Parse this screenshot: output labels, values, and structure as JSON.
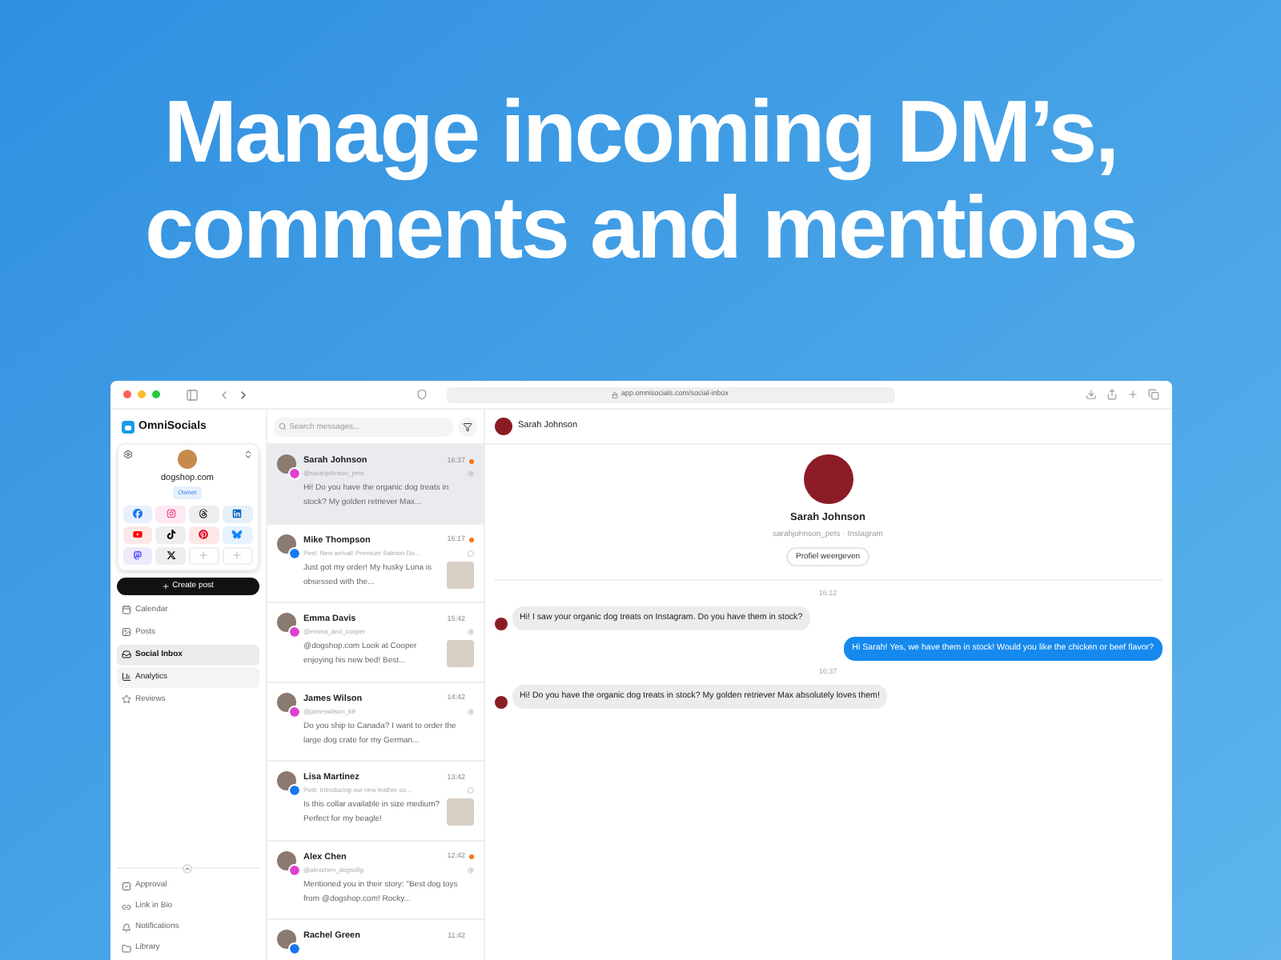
{
  "headline": [
    "Manage incoming DM’s,",
    "comments and mentions"
  ],
  "browser": {
    "url": "app.omnisocials.com/social-inbox"
  },
  "sidebar": {
    "brand": "OmniSocials",
    "account": {
      "name": "dogshop.com",
      "role": "Owner"
    },
    "socials": [
      {
        "kind": "facebook"
      },
      {
        "kind": "instagram"
      },
      {
        "kind": "threads"
      },
      {
        "kind": "linkedin"
      },
      {
        "kind": "youtube"
      },
      {
        "kind": "tiktok"
      },
      {
        "kind": "pinterest"
      },
      {
        "kind": "bluesky"
      },
      {
        "kind": "mastodon"
      },
      {
        "kind": "x"
      },
      {
        "kind": "add"
      },
      {
        "kind": "add"
      }
    ],
    "create_button": "Create post",
    "nav": [
      {
        "label": "Calendar",
        "selected": false,
        "hovered": false
      },
      {
        "label": "Posts",
        "selected": false,
        "hovered": false
      },
      {
        "label": "Social Inbox",
        "selected": true,
        "hovered": false
      },
      {
        "label": "Analytics",
        "selected": false,
        "hovered": true
      },
      {
        "label": "Reviews",
        "selected": false,
        "hovered": false
      }
    ],
    "footer": [
      {
        "label": "Approval"
      },
      {
        "label": "Link in Bio"
      },
      {
        "label": "Notifications"
      },
      {
        "label": "Library"
      }
    ]
  },
  "search": {
    "placeholder": "Search messages..."
  },
  "conversations": [
    {
      "name": "Sarah Johnson",
      "handle": "@sarahjohnson_pets",
      "time": "16:37",
      "unread": true,
      "color": "#e040d0",
      "message": "Hi! Do you have the organic dog treats in stock? My golden retriever Max...",
      "attachment": false,
      "selected": true
    },
    {
      "name": "Mike Thompson",
      "post": "Post: New arrival! Premium Salmon Do...",
      "time": "16:17",
      "unread": true,
      "color": "#1877f2",
      "message": "Just got my order! My husky Luna is obsessed with the...",
      "attachment": true,
      "selected": false
    },
    {
      "name": "Emma Davis",
      "handle": "@emma_and_cooper",
      "time": "15:42",
      "unread": false,
      "color": "#e040d0",
      "message": "@dogshop.com Look at Cooper enjoying his new bed! Best...",
      "attachment": true,
      "selected": false
    },
    {
      "name": "James Wilson",
      "handle": "@jameswilson_k9",
      "time": "14:42",
      "unread": false,
      "color": "#e040d0",
      "message": "Do you ship to Canada? I want to order the large dog crate for my German...",
      "attachment": false,
      "selected": false
    },
    {
      "name": "Lisa Martinez",
      "post": "Post: Introducing our new leather co...",
      "time": "13:42",
      "unread": false,
      "color": "#1877f2",
      "message": "Is this collar available in size medium? Perfect for my beagle!",
      "attachment": true,
      "selected": false
    },
    {
      "name": "Alex Chen",
      "handle": "@alexchen_dogsofig",
      "time": "12:42",
      "unread": true,
      "color": "#e040d0",
      "message": "Mentioned you in their story: \"Best dog toys from @dogshop.com! Rocky...",
      "attachment": false,
      "selected": false
    },
    {
      "name": "Rachel Green",
      "time": "11:42",
      "unread": false,
      "color": "#1877f2",
      "selected": false
    }
  ],
  "chat": {
    "header": "Sarah Johnson",
    "profile": {
      "name": "Sarah Johnson",
      "subtitle": "sarahjohnson_pets · Instagram",
      "button": "Profiel weergeven"
    },
    "messages": [
      {
        "kind": "timestamp",
        "text": "16:12"
      },
      {
        "kind": "incoming",
        "text": "Hi! I saw your organic dog treats on Instagram. Do you have them in stock?"
      },
      {
        "kind": "outgoing",
        "text": "Hi Sarah! Yes, we have them in stock! Would you like the chicken or beef flavor?"
      },
      {
        "kind": "timestamp",
        "text": "16:37"
      },
      {
        "kind": "incoming",
        "text": "Hi! Do you have the organic dog treats in stock? My golden retriever Max absolutely loves them!"
      }
    ]
  }
}
